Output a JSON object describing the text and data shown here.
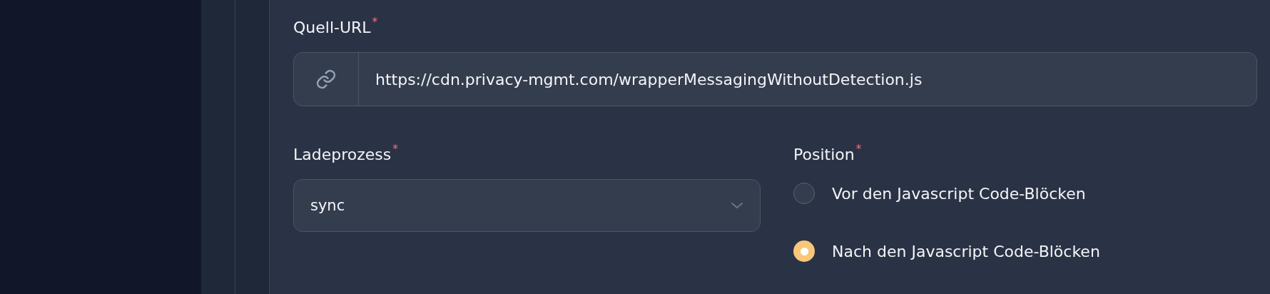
{
  "source_url": {
    "label": "Quell-URL",
    "required_mark": "*",
    "value": "https://cdn.privacy-mgmt.com/wrapperMessagingWithoutDetection.js"
  },
  "loading": {
    "label": "Ladeprozess",
    "required_mark": "*",
    "value": "sync"
  },
  "position": {
    "label": "Position",
    "required_mark": "*",
    "options": [
      {
        "label": "Vor den Javascript Code-Blöcken",
        "selected": false
      },
      {
        "label": "Nach den Javascript Code-Blöcken",
        "selected": true
      }
    ]
  }
}
